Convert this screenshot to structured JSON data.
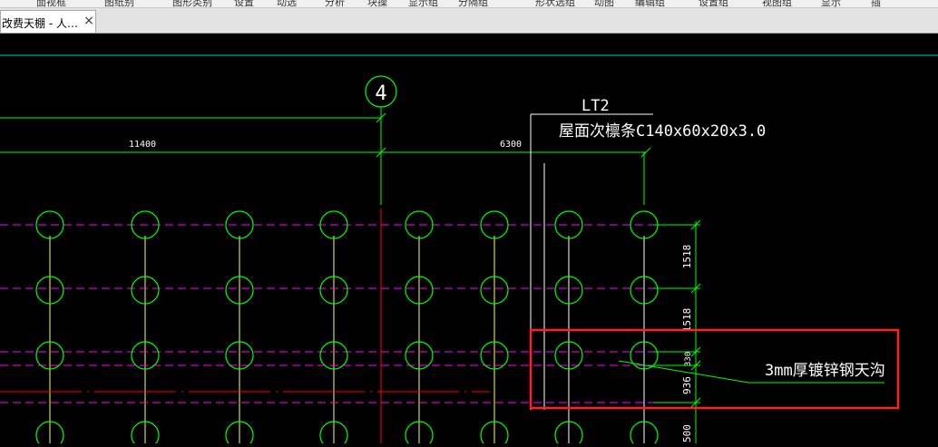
{
  "menu": {
    "items": [
      "面视框",
      "图纸别",
      "图形类别",
      "设置",
      "动选",
      "分析",
      "块操",
      "显示组",
      "分隔组",
      "形状选组",
      "动图",
      "编辑组",
      "设置组",
      "视图组",
      "显示",
      "插"
    ]
  },
  "tab": {
    "label": "改费天棚 - 人…",
    "close_glyph": "×"
  },
  "drawing": {
    "axis_label": "4",
    "dim_left": "11400",
    "dim_right": "6300",
    "title_line1": "LT2",
    "title_line2": "屋面次檩条C140x60x20x3.0",
    "vdim_1": "1518",
    "vdim_2": "1518",
    "vdim_3": "330",
    "vdim_4": "936",
    "vdim_5": "500",
    "annotation": "3mm厚镀锌钢天沟"
  },
  "colors": {
    "background": "#000000",
    "green": "#00ff00",
    "magenta": "#ff00ff",
    "yellow": "#ffff66",
    "red": "#ff0000",
    "white": "#ffffff",
    "cyan": "#00c8c8",
    "highlight": "#ff2020"
  }
}
